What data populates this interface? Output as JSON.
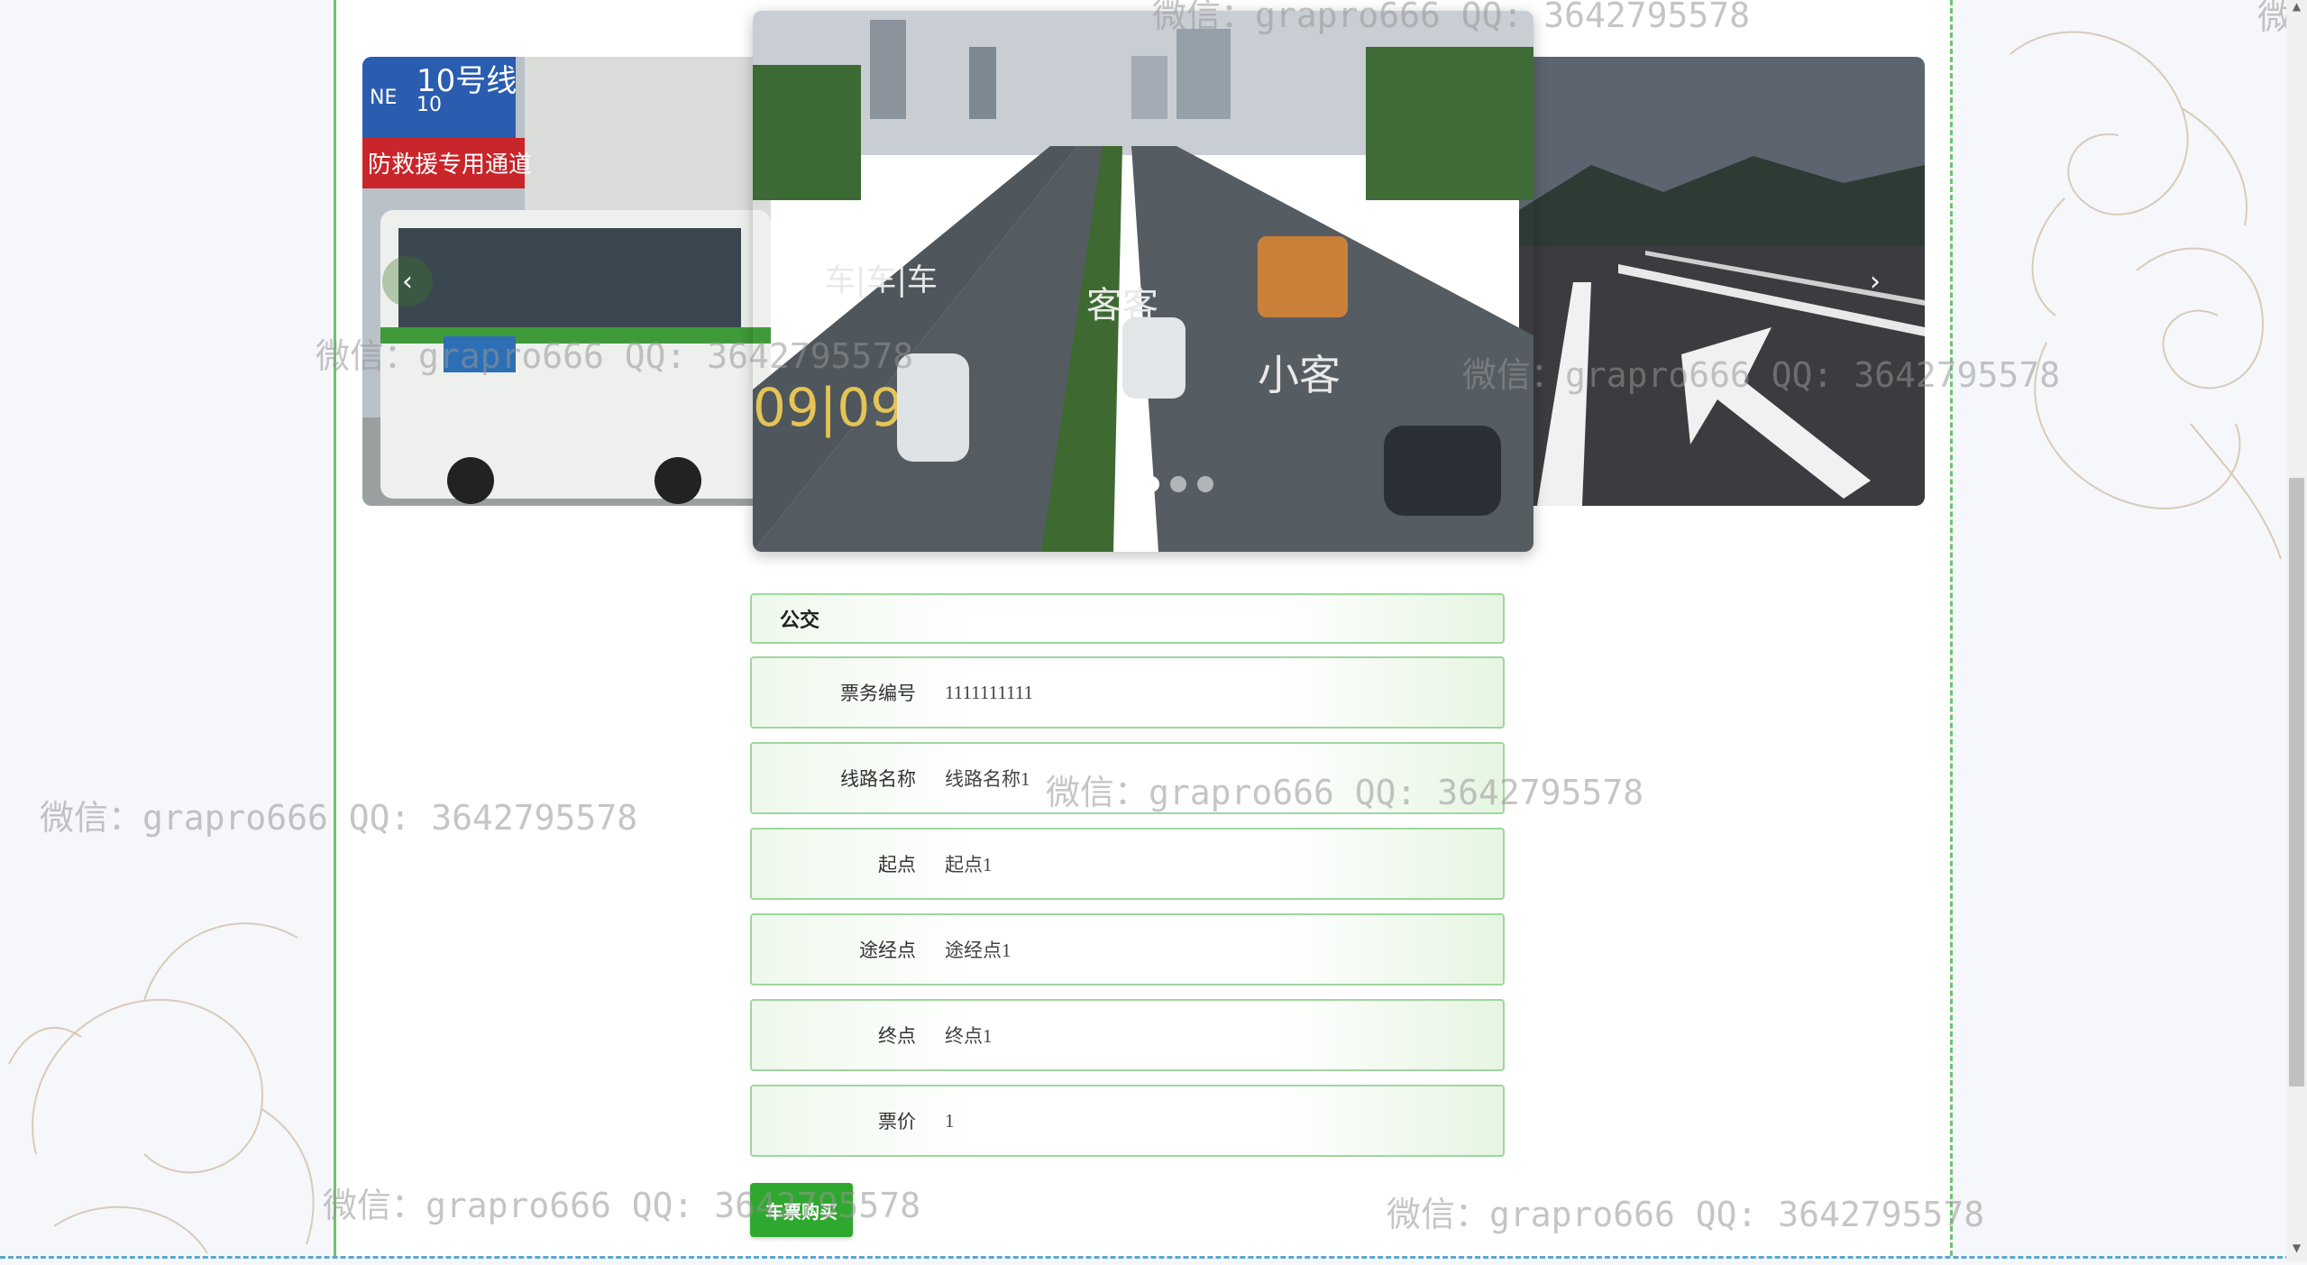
{
  "carousel": {
    "prev_icon": "chevron-left-icon",
    "next_icon": "chevron-right-icon",
    "prev_glyph": "‹",
    "next_glyph": "›",
    "slide_count": 3,
    "active_index": 0,
    "left_slide_signs": {
      "line": "10号线",
      "line_en": "NE",
      "line_no": "10",
      "rescue": "防救援专用通道"
    },
    "center_slide_marks": {
      "lane_text1": "车|车|车",
      "lane_text2": "客客",
      "lane_text3": "小客",
      "lane_text4": "09|09"
    }
  },
  "detail": {
    "title": "公交",
    "fields": [
      {
        "label": "票务编号",
        "value": "1111111111"
      },
      {
        "label": "线路名称",
        "value": "线路名称1"
      },
      {
        "label": "起点",
        "value": "起点1"
      },
      {
        "label": "途经点",
        "value": "途经点1"
      },
      {
        "label": "终点",
        "value": "终点1"
      },
      {
        "label": "票价",
        "value": "1"
      }
    ],
    "buy_button": "车票购买"
  },
  "watermarks": {
    "text": "微信：grapro666 QQ: 3642795578",
    "top_partial": "微信：grapro666 QQ: 3642795578",
    "right_partial": "微"
  },
  "colors": {
    "accent_green": "#2ea82e",
    "border_green": "#9ed69e"
  }
}
